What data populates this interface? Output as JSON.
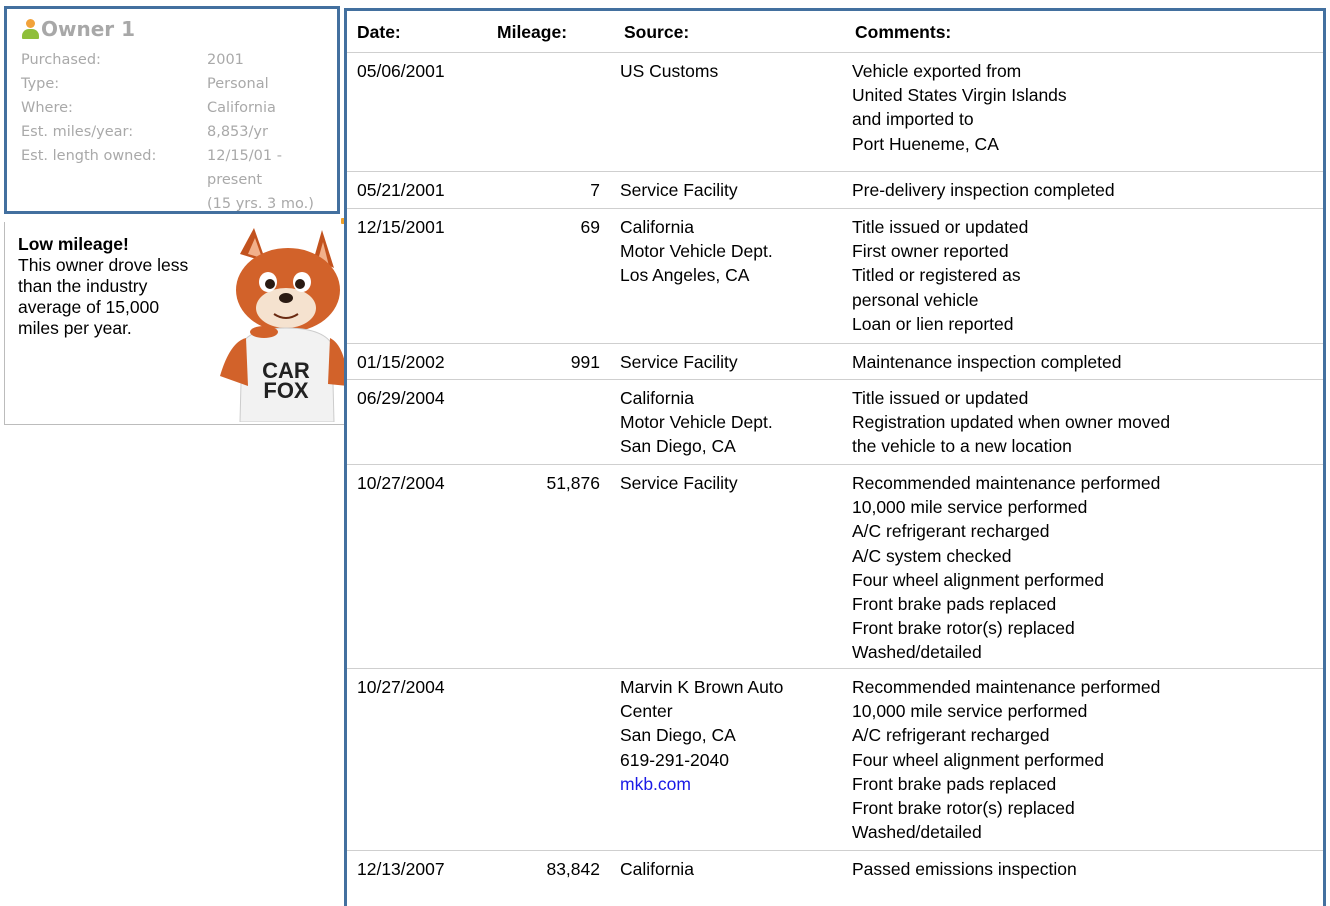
{
  "owner": {
    "title": "Owner 1",
    "fields": [
      {
        "label": "Purchased:",
        "value": "2001"
      },
      {
        "label": "Type:",
        "value": "Personal"
      },
      {
        "label": "Where:",
        "value": "California"
      },
      {
        "label": "Est. miles/year:",
        "value": "8,853/yr"
      },
      {
        "label": "Est. length owned:",
        "value": "12/15/01 -"
      }
    ],
    "length_line2": "present",
    "length_line3": "(15 yrs. 3 mo.)"
  },
  "mileage_note": {
    "heading": "Low mileage!",
    "body": "This owner drove less than the industry average of 15,000 miles per year.",
    "mascot_shirt": "CAR FOX"
  },
  "history": {
    "headers": {
      "date": "Date:",
      "mileage": "Mileage:",
      "source": "Source:",
      "comments": "Comments:"
    },
    "rows": [
      {
        "date": "05/06/2001",
        "mileage": "",
        "source": "US Customs",
        "comments": "Vehicle exported from\nUnited States Virgin Islands\nand imported to\nPort Hueneme, CA"
      },
      {
        "date": "05/21/2001",
        "mileage": "7",
        "source": "Service Facility",
        "comments": "Pre-delivery inspection completed"
      },
      {
        "date": "12/15/2001",
        "mileage": "69",
        "source": "California\nMotor Vehicle Dept.\nLos Angeles, CA",
        "comments": "Title issued or updated\nFirst owner reported\nTitled or registered as\npersonal vehicle\nLoan or lien reported"
      },
      {
        "date": "01/15/2002",
        "mileage": "991",
        "source": "Service Facility",
        "comments": "Maintenance inspection completed"
      },
      {
        "date": "06/29/2004",
        "mileage": "",
        "source": "California\nMotor Vehicle Dept.\nSan Diego, CA",
        "comments": "Title issued or updated\nRegistration updated when owner moved\nthe vehicle to a new location"
      },
      {
        "date": "10/27/2004",
        "mileage": "51,876",
        "source": "Service Facility",
        "comments": "Recommended maintenance performed\n10,000 mile service performed\nA/C refrigerant recharged\nA/C system checked\nFour wheel alignment performed\nFront brake pads replaced\nFront brake rotor(s) replaced\nWashed/detailed"
      },
      {
        "date": "10/27/2004",
        "mileage": "",
        "source": "Marvin K Brown Auto\nCenter\nSan Diego, CA\n619-291-2040",
        "source_link": "mkb.com",
        "comments": "Recommended maintenance performed\n10,000 mile service performed\nA/C refrigerant recharged\nFour wheel alignment performed\nFront brake pads replaced\nFront brake rotor(s) replaced\nWashed/detailed"
      },
      {
        "date": "12/13/2007",
        "mileage": "83,842",
        "source": "California",
        "comments": "Passed emissions inspection"
      }
    ]
  },
  "colors": {
    "frame": "#43709f",
    "muted_text": "#a9a9a9",
    "link": "#1a1ae6"
  }
}
